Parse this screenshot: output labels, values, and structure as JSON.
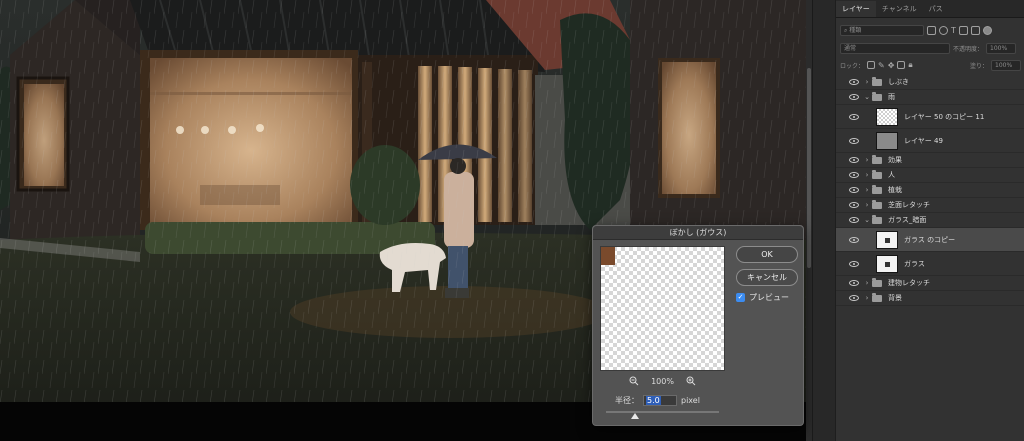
{
  "dialog": {
    "title": "ぼかし (ガウス)",
    "ok_label": "OK",
    "cancel_label": "キャンセル",
    "preview_label": "プレビュー",
    "preview_checked": true,
    "zoom_level": "100%",
    "radius_label": "半径：",
    "radius_value": "5.0",
    "radius_unit": "pixel"
  },
  "panel": {
    "tabs": [
      {
        "label": "レイヤー",
        "active": true
      },
      {
        "label": "チャンネル",
        "active": false
      },
      {
        "label": "パス",
        "active": false
      }
    ],
    "search_placeholder": "種類",
    "blend_mode": "通常",
    "opacity_label": "不透明度：",
    "opacity_value": "100%",
    "lock_label": "ロック：",
    "fill_label": "塗り：",
    "fill_value": "100%",
    "layers": [
      {
        "name": "しぶき",
        "kind": "group",
        "expanded": false
      },
      {
        "name": "雨",
        "kind": "group",
        "expanded": true
      },
      {
        "name": "レイヤー 50 のコピー 11",
        "kind": "layer",
        "thumb": "checker",
        "indent": 1
      },
      {
        "name": "レイヤー 49",
        "kind": "layer",
        "thumb": "gray",
        "indent": 1
      },
      {
        "name": "効果",
        "kind": "group",
        "expanded": false
      },
      {
        "name": "人",
        "kind": "group",
        "expanded": false
      },
      {
        "name": "植栽",
        "kind": "group",
        "expanded": false
      },
      {
        "name": "芝面レタッチ",
        "kind": "group",
        "expanded": false
      },
      {
        "name": "ガラス_暗面",
        "kind": "group",
        "expanded": true
      },
      {
        "name": "ガラス のコピー",
        "kind": "layer",
        "thumb": "mask",
        "indent": 1,
        "selected": true
      },
      {
        "name": "ガラス",
        "kind": "layer",
        "thumb": "mask",
        "indent": 1
      },
      {
        "name": "建物レタッチ",
        "kind": "group",
        "expanded": false
      },
      {
        "name": "背景",
        "kind": "group",
        "expanded": false
      }
    ]
  },
  "colors": {
    "accent": "#3c8cf0",
    "panel_bg": "#323232",
    "dialog_bg": "#535353"
  }
}
